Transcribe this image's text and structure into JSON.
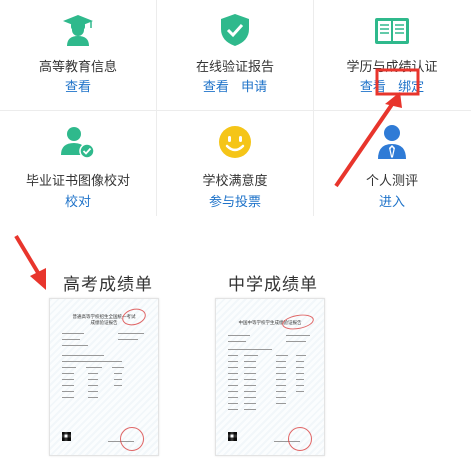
{
  "row1": [
    {
      "title": "高等教育信息",
      "links": [
        "查看"
      ]
    },
    {
      "title": "在线验证报告",
      "links": [
        "查看",
        "申请"
      ]
    },
    {
      "title": "学历与成绩认证",
      "links": [
        "查看",
        "绑定"
      ]
    }
  ],
  "row2": [
    {
      "title": "毕业证书图像校对",
      "links": [
        "校对"
      ]
    },
    {
      "title": "学校满意度",
      "links": [
        "参与投票"
      ]
    },
    {
      "title": "个人测评",
      "links": [
        "进入"
      ]
    }
  ],
  "sections": {
    "left": "高考成绩单",
    "right": "中学成绩单"
  },
  "docs": {
    "left_title": "普通高等学校招生全国统一考试\n成绩验证报告",
    "right_title": "中国中等学校学生成绩验证报告"
  },
  "colors": {
    "icon_green": "#2fb98c",
    "icon_yellow": "#f5c518",
    "icon_blue": "#2f7bd6",
    "link_blue": "#1f73c9",
    "highlight_red": "#e8352c"
  }
}
